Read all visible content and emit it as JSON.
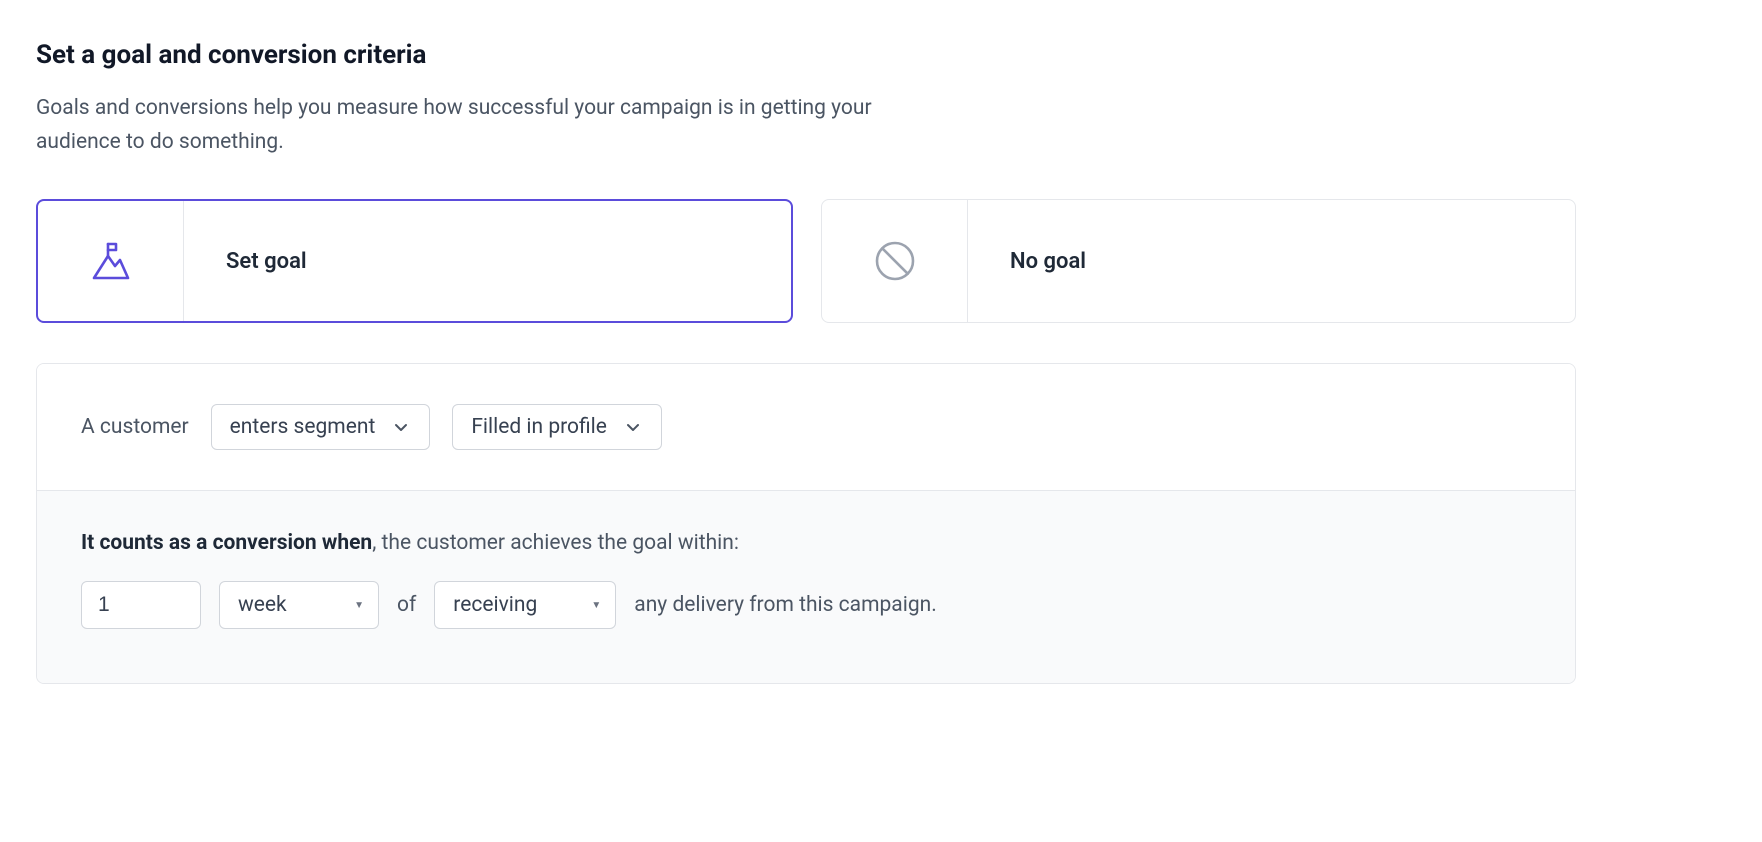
{
  "header": {
    "title": "Set a goal and conversion criteria",
    "description": "Goals and conversions help you measure how successful your campaign is in getting your audience to do something."
  },
  "cards": {
    "set_goal": {
      "label": "Set goal"
    },
    "no_goal": {
      "label": "No goal"
    }
  },
  "goal_condition": {
    "prefix": "A customer",
    "action_select": "enters segment",
    "segment_select": "Filled in profile"
  },
  "conversion": {
    "lead_bold": "It counts as a conversion when",
    "lead_rest": ", the customer achieves the goal within:",
    "amount": "1",
    "unit": "week",
    "of_label": "of",
    "event": "receiving",
    "trail": "any delivery from this campaign."
  }
}
